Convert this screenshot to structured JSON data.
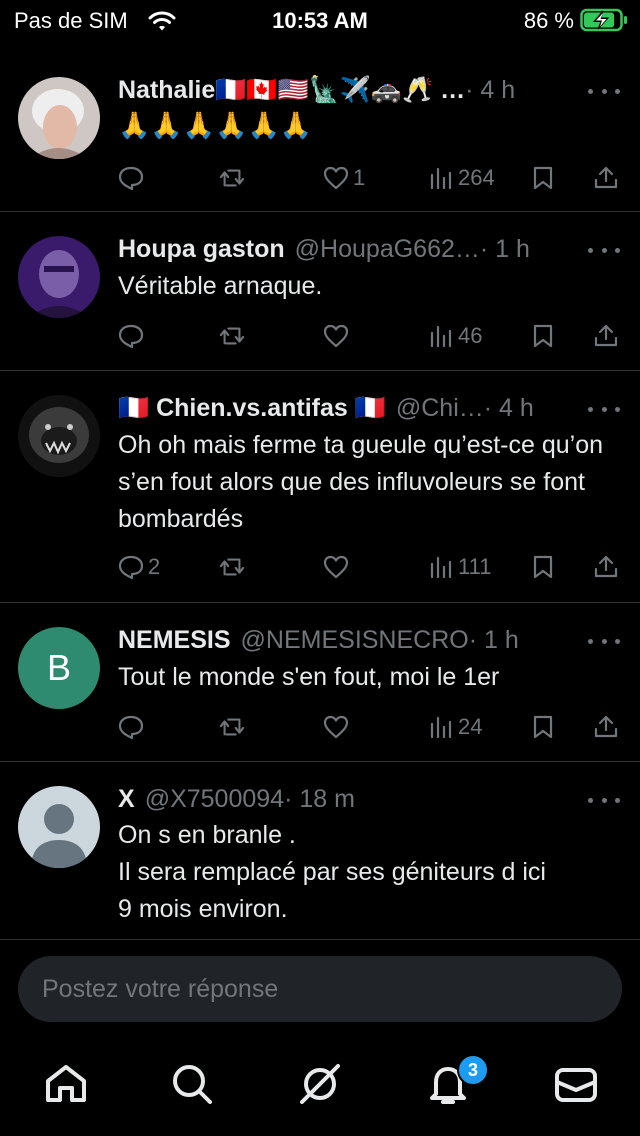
{
  "status_bar": {
    "carrier": "Pas de SIM",
    "time": "10:53 AM",
    "battery_percent": "86 %",
    "battery_level": 0.86
  },
  "tweets": [
    {
      "name": "Nathalie🇫🇷🇨🇦🇺🇸🗽✈️🚓🥂 …",
      "handle": "",
      "time": " · 4 h",
      "text": "🙏🙏🙏🙏🙏🙏",
      "replies": "",
      "likes": "1",
      "views": "264"
    },
    {
      "name": "Houpa gaston",
      "handle": "@HoupaG662…",
      "time": " · 1 h",
      "text": "Véritable arnaque.",
      "replies": "",
      "likes": "",
      "views": "46"
    },
    {
      "name": "🇫🇷 Chien.vs.antifas 🇫🇷",
      "handle": "@Chi…",
      "time": " · 4 h",
      "text": "Oh oh mais ferme ta gueule qu’est-ce qu’on s’en fout alors que des influvoleurs se font bombardés",
      "replies": "2",
      "likes": "",
      "views": "111"
    },
    {
      "name": "NEMESIS",
      "handle": "@NEMESISNECRO",
      "time": " · 1 h",
      "text": "Tout le monde s'en fout, moi le 1er",
      "avatar_letter": "B",
      "avatar_color": "#2e8b6f",
      "replies": "",
      "likes": "",
      "views": "24"
    },
    {
      "name": "X",
      "handle": "@X7500094",
      "time": " · 18 m",
      "text_lines": [
        "On s en branle .",
        "Il sera remplacé par ses géniteurs d ici",
        "9 mois environ."
      ]
    }
  ],
  "reply_box": {
    "placeholder": "Postez votre réponse"
  },
  "nav": {
    "notifications_badge": "3"
  },
  "colors": {
    "background": "#000000",
    "text": "#e7e9ea",
    "muted": "#71767b",
    "divider": "#2f3336",
    "accent": "#1d9bf0",
    "battery_green": "#34c759"
  }
}
